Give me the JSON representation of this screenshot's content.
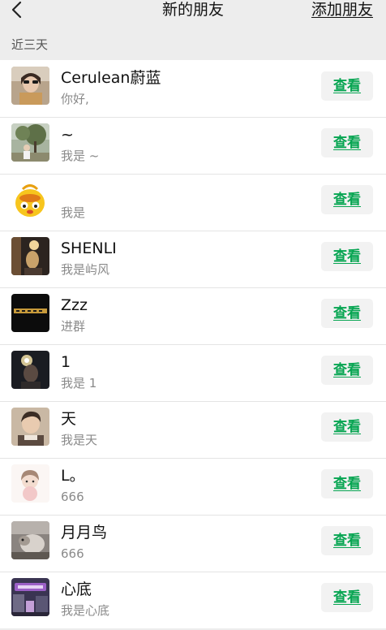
{
  "header": {
    "title": "新的朋友",
    "action_label": "添加朋友",
    "back_icon": "chevron-left-icon"
  },
  "section": {
    "label": "近三天"
  },
  "button_label": "查看",
  "colors": {
    "accent_green": "#07a552",
    "background": "#ededed",
    "row_background": "#ffffff",
    "button_background": "#f2f2f2",
    "secondary_text": "#8a8a8a"
  },
  "requests": [
    {
      "name": "Cerulean蔚蓝",
      "message": "你好,",
      "avatar": "avatar-girl-sunglasses"
    },
    {
      "name": "~",
      "message": "我是 ~",
      "avatar": "avatar-tree-park"
    },
    {
      "name": "",
      "message": "我是",
      "avatar": "avatar-yellow-cartoon-duck"
    },
    {
      "name": "SHENLI",
      "message": "我是屿风",
      "avatar": "avatar-dark-room-figure"
    },
    {
      "name": "Zzz",
      "message": "进群",
      "avatar": "avatar-dark-neon-sign"
    },
    {
      "name": "1",
      "message": "我是 1",
      "avatar": "avatar-dark-portrait-glow"
    },
    {
      "name": "天",
      "message": "我是天",
      "avatar": "avatar-boy-portrait"
    },
    {
      "name": "L。",
      "message": "666",
      "avatar": "avatar-cartoon-girl"
    },
    {
      "name": "月月鸟",
      "message": "666",
      "avatar": "avatar-animal-photo"
    },
    {
      "name": "心底",
      "message": "我是心底",
      "avatar": "avatar-city-street-purple"
    }
  ]
}
